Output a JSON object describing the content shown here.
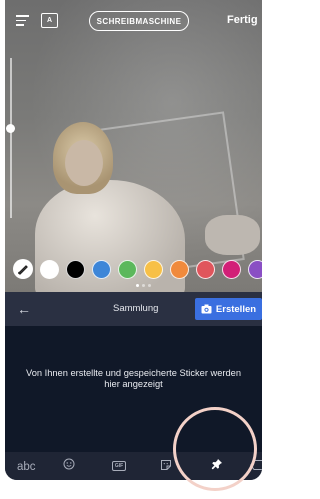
{
  "topbar": {
    "menu_icon": "menu-icon",
    "font_icon_label": "A",
    "font_style_label": "SCHREIBMASCHINE",
    "done_label": "Fertig"
  },
  "colors": {
    "brush_icon": "brush-icon",
    "swatches": [
      "#ffffff",
      "#000000",
      "#3d86d8",
      "#5cb85c",
      "#f7c047",
      "#f08a3c",
      "#e0555c",
      "#d21f77",
      "#8a4fc4"
    ],
    "page_dots": 3,
    "active_page": 1
  },
  "panel": {
    "back_icon": "arrow-left-icon",
    "collection_label": "Sammlung",
    "create_label": "Erstellen",
    "empty_message": "Von Ihnen erstellte und gespeicherte Sticker werden hier angezeigt"
  },
  "toolbar": {
    "abc_label": "abc",
    "gif_label": "GIF",
    "icons": [
      "emoji-icon",
      "gif-icon",
      "sticker-icon",
      "pin-icon",
      "backspace-icon"
    ]
  },
  "accent": "#3a6fe0"
}
